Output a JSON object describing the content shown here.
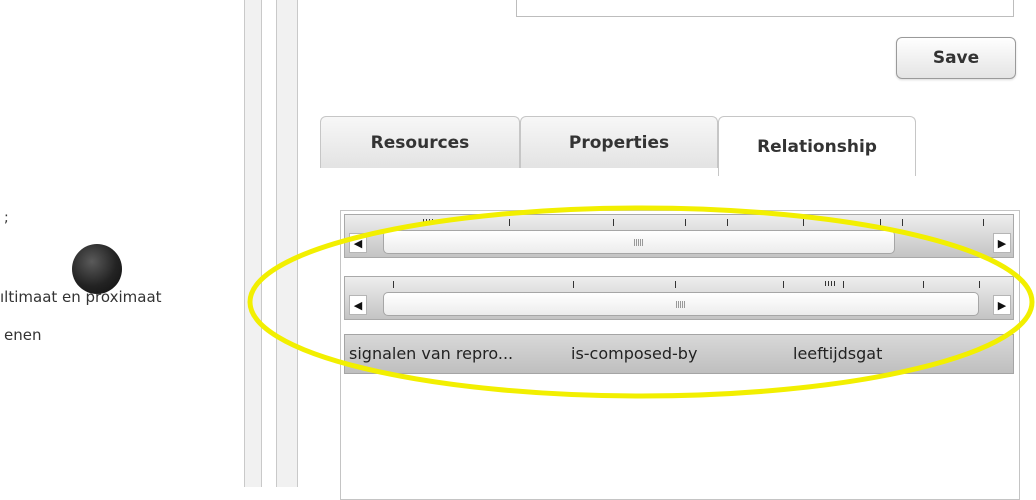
{
  "left_panel": {
    "mark": ";",
    "node_label": "ıltimaat en proximaat",
    "node_label_2": "enen"
  },
  "toolbar": {
    "save_label": "Save"
  },
  "tabs": [
    {
      "label": "Resources",
      "active": false
    },
    {
      "label": "Properties",
      "active": false
    },
    {
      "label": "Relationship",
      "active": true
    }
  ],
  "relationship": {
    "row": {
      "source": "signalen van repro...",
      "relation": "is-composed-by",
      "target": "leeftijdsgat"
    }
  },
  "icons": {
    "scroll_left": "◀",
    "scroll_right": "▶"
  },
  "colors": {
    "annotation": "#f2ef00",
    "node": "#222222"
  }
}
